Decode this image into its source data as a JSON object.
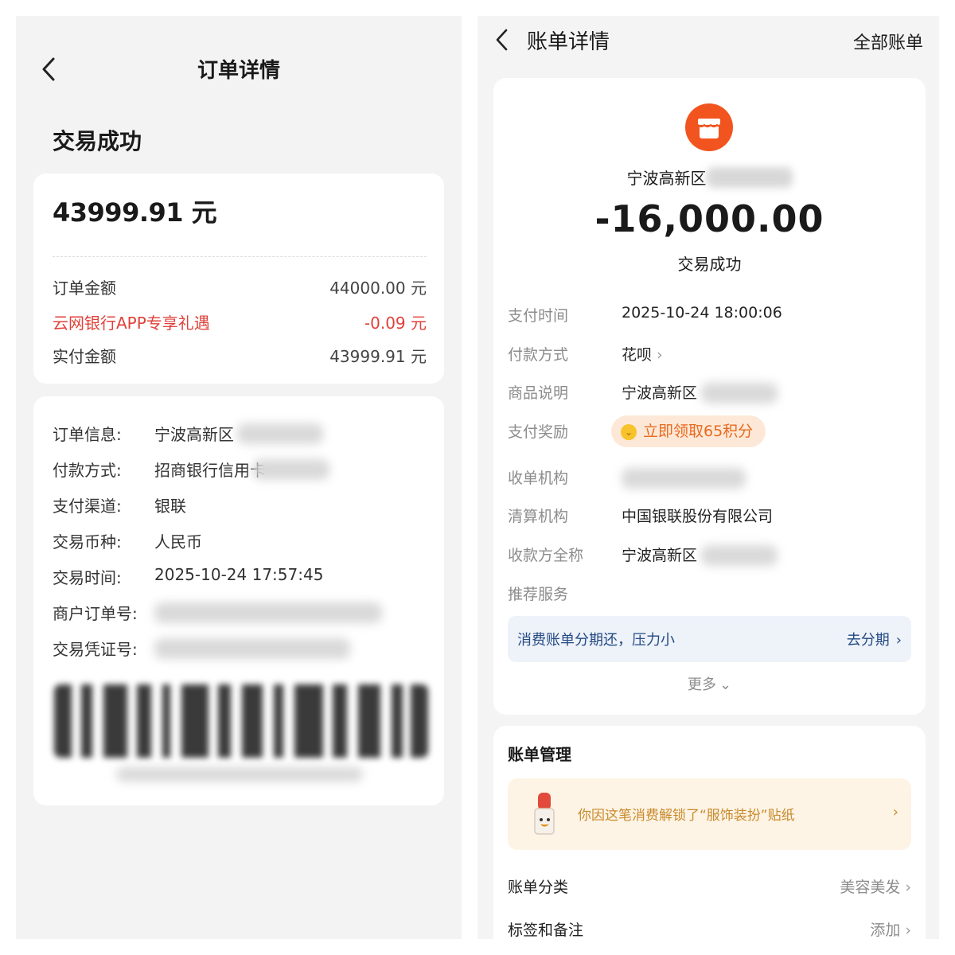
{
  "left": {
    "title": "订单详情",
    "status": "交易成功",
    "amount": "43999.91 元",
    "price_rows": [
      {
        "label": "订单金额",
        "value": "44000.00 元"
      },
      {
        "label": "云网银行APP专享礼遇",
        "value": "-0.09 元"
      },
      {
        "label": "实付金额",
        "value": "43999.91 元"
      }
    ],
    "info_rows": [
      {
        "label": "订单信息:",
        "value": "宁波高新区"
      },
      {
        "label": "付款方式:",
        "value": "招商银行信用卡"
      },
      {
        "label": "支付渠道:",
        "value": "银联"
      },
      {
        "label": "交易币种:",
        "value": "人民币"
      },
      {
        "label": "交易时间:",
        "value": "2025-10-24 17:57:45"
      },
      {
        "label": "商户订单号:",
        "value": ""
      },
      {
        "label": "交易凭证号:",
        "value": ""
      }
    ],
    "discount_color": "#e0413a"
  },
  "right": {
    "title": "账单详情",
    "all_bills": "全部账单",
    "merchant": "宁波高新区",
    "amount": "-16,000.00",
    "status": "交易成功",
    "rows": {
      "pay_time": {
        "label": "支付时间",
        "value": "2025-10-24 18:00:06"
      },
      "pay_method": {
        "label": "付款方式",
        "value": "花呗"
      },
      "goods": {
        "label": "商品说明",
        "value": "宁波高新区"
      },
      "reward": {
        "label": "支付奖励",
        "value": "立即领取65积分"
      },
      "acquirer": {
        "label": "收单机构",
        "value": ""
      },
      "clearing": {
        "label": "清算机构",
        "value": "中国银联股份有限公司"
      },
      "payee": {
        "label": "收款方全称",
        "value": "宁波高新区"
      },
      "recommend": {
        "label": "推荐服务"
      }
    },
    "installment": {
      "text": "消费账单分期还，压力小",
      "action": "去分期"
    },
    "more": "更多",
    "bill_management": {
      "title": "账单管理",
      "sticker_text": "你因这笔消费解锁了“服饰装扮”贴纸",
      "category": {
        "label": "账单分类",
        "value": "美容美发"
      },
      "tags": {
        "label": "标签和备注",
        "value": "添加"
      }
    },
    "icon_color": "#f2541f",
    "accent_blue": "#234a84"
  }
}
